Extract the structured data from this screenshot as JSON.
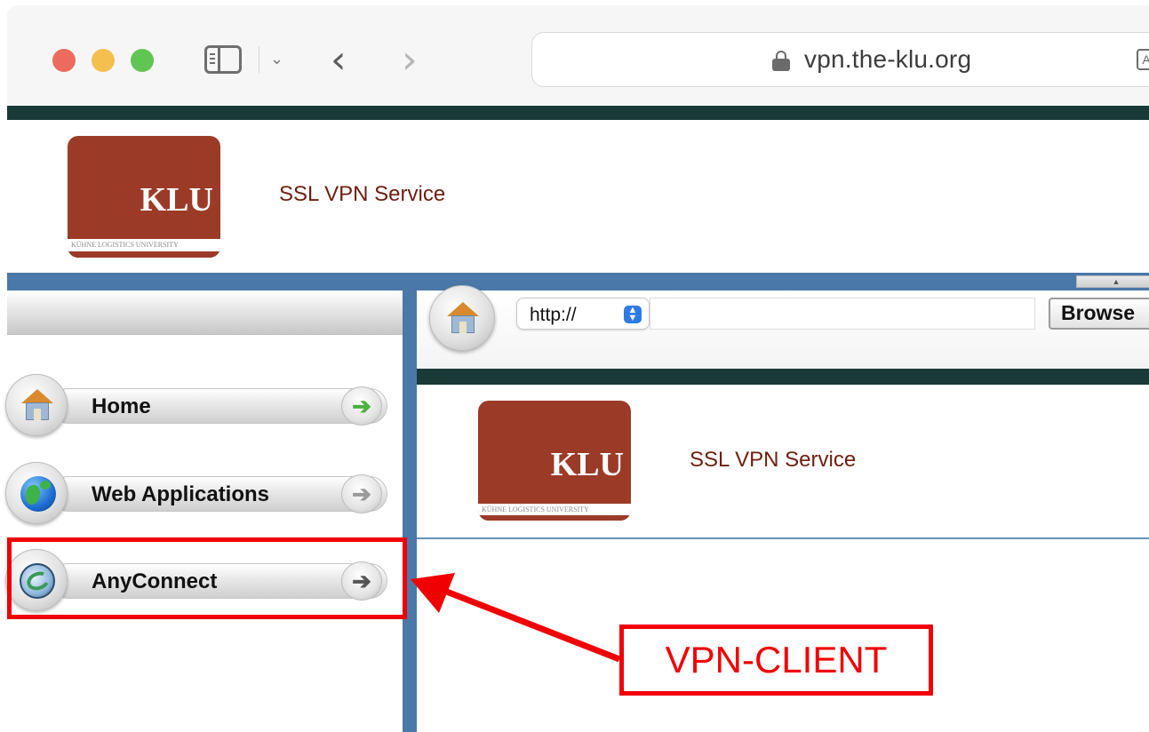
{
  "browser": {
    "url": "vpn.the-klu.org",
    "colors": {
      "close": "#ed6a5e",
      "minimize": "#f5bf4f",
      "zoom": "#61c554"
    }
  },
  "header": {
    "logo": {
      "word": "KLU",
      "tagline": "KÜHNE LOGISTICS UNIVERSITY"
    },
    "title": "SSL VPN Service"
  },
  "sidebar": {
    "items": [
      {
        "label": "Home",
        "icon": "house-icon"
      },
      {
        "label": "Web Applications",
        "icon": "globe-icon"
      },
      {
        "label": "AnyConnect",
        "icon": "anyconnect-icon"
      }
    ]
  },
  "toolbar": {
    "protocol": "http://",
    "url_value": "",
    "browse_label": "Browse"
  },
  "content": {
    "logo": {
      "word": "KLU",
      "tagline": "KÜHNE LOGISTICS UNIVERSITY"
    },
    "title": "SSL VPN Service"
  },
  "annotation": {
    "callout_text": "VPN-CLIENT",
    "color": "#f00000"
  },
  "theme": {
    "brand": "#9b3b27",
    "dark_bar": "#1a3a37",
    "frame_blue": "#4a78a8",
    "title_color": "#6d1f10"
  }
}
